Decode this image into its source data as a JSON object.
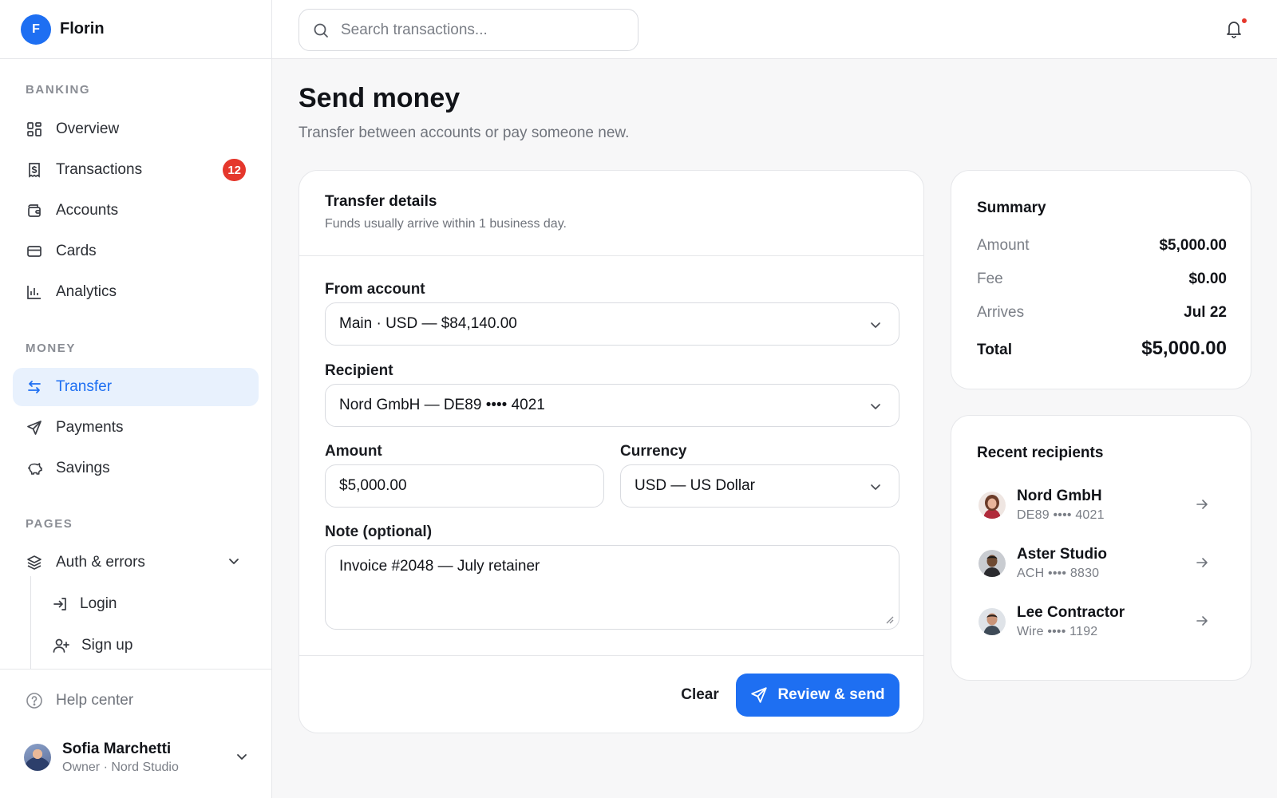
{
  "brand": {
    "initial": "F",
    "name": "Florin"
  },
  "sidebar": {
    "sections": [
      {
        "label": "BANKING"
      },
      {
        "label": "MONEY"
      },
      {
        "label": "PAGES"
      }
    ],
    "banking": [
      {
        "label": "Overview",
        "icon": "grid-icon"
      },
      {
        "label": "Transactions",
        "icon": "receipt-icon",
        "badge": "12"
      },
      {
        "label": "Accounts",
        "icon": "wallet-icon"
      },
      {
        "label": "Cards",
        "icon": "credit-card-icon"
      },
      {
        "label": "Analytics",
        "icon": "bar-chart-icon"
      }
    ],
    "money": [
      {
        "label": "Transfer",
        "icon": "arrows-swap-icon",
        "active": true
      },
      {
        "label": "Payments",
        "icon": "send-icon"
      },
      {
        "label": "Savings",
        "icon": "piggy-bank-icon"
      }
    ],
    "pages": [
      {
        "label": "Auth & errors",
        "icon": "layers-icon",
        "expanded": true
      }
    ],
    "auth_sub": [
      {
        "label": "Login",
        "icon": "login-icon"
      },
      {
        "label": "Sign up",
        "icon": "user-plus-icon"
      }
    ],
    "help": "Help center",
    "user": {
      "name": "Sofia Marchetti",
      "role": "Owner · Nord Studio"
    }
  },
  "search": {
    "placeholder": "Search transactions...",
    "value": ""
  },
  "page": {
    "title": "Send money",
    "subtitle": "Transfer between accounts or pay someone new."
  },
  "transfer": {
    "title": "Transfer details",
    "subtitle": "Funds usually arrive within 1 business day.",
    "from_label": "From account",
    "from_value": "Main · USD — $84,140.00",
    "recipient_label": "Recipient",
    "recipient_value": "Nord GmbH — DE89 •••• 4021",
    "amount_label": "Amount",
    "amount_value": "$5,000.00",
    "currency_label": "Currency",
    "currency_value": "USD — US Dollar",
    "note_label": "Note (optional)",
    "note_value": "Invoice #2048 — July retainer",
    "clear_label": "Clear",
    "submit_label": "Review & send"
  },
  "summary": {
    "title": "Summary",
    "rows": [
      {
        "label": "Amount",
        "value": "$5,000.00"
      },
      {
        "label": "Fee",
        "value": "$0.00"
      },
      {
        "label": "Arrives",
        "value": "Jul 22"
      },
      {
        "label": "Total",
        "value": "$5,000.00"
      }
    ]
  },
  "recent": {
    "title": "Recent recipients",
    "items": [
      {
        "name": "Nord GmbH",
        "account": "DE89 •••• 4021"
      },
      {
        "name": "Aster Studio",
        "account": "ACH •••• 8830"
      },
      {
        "name": "Lee Contractor",
        "account": "Wire •••• 1192"
      }
    ]
  },
  "colors": {
    "accent": "#1e6ff2",
    "accent_soft": "#e8f1fd",
    "badge_red": "#e5372c"
  }
}
